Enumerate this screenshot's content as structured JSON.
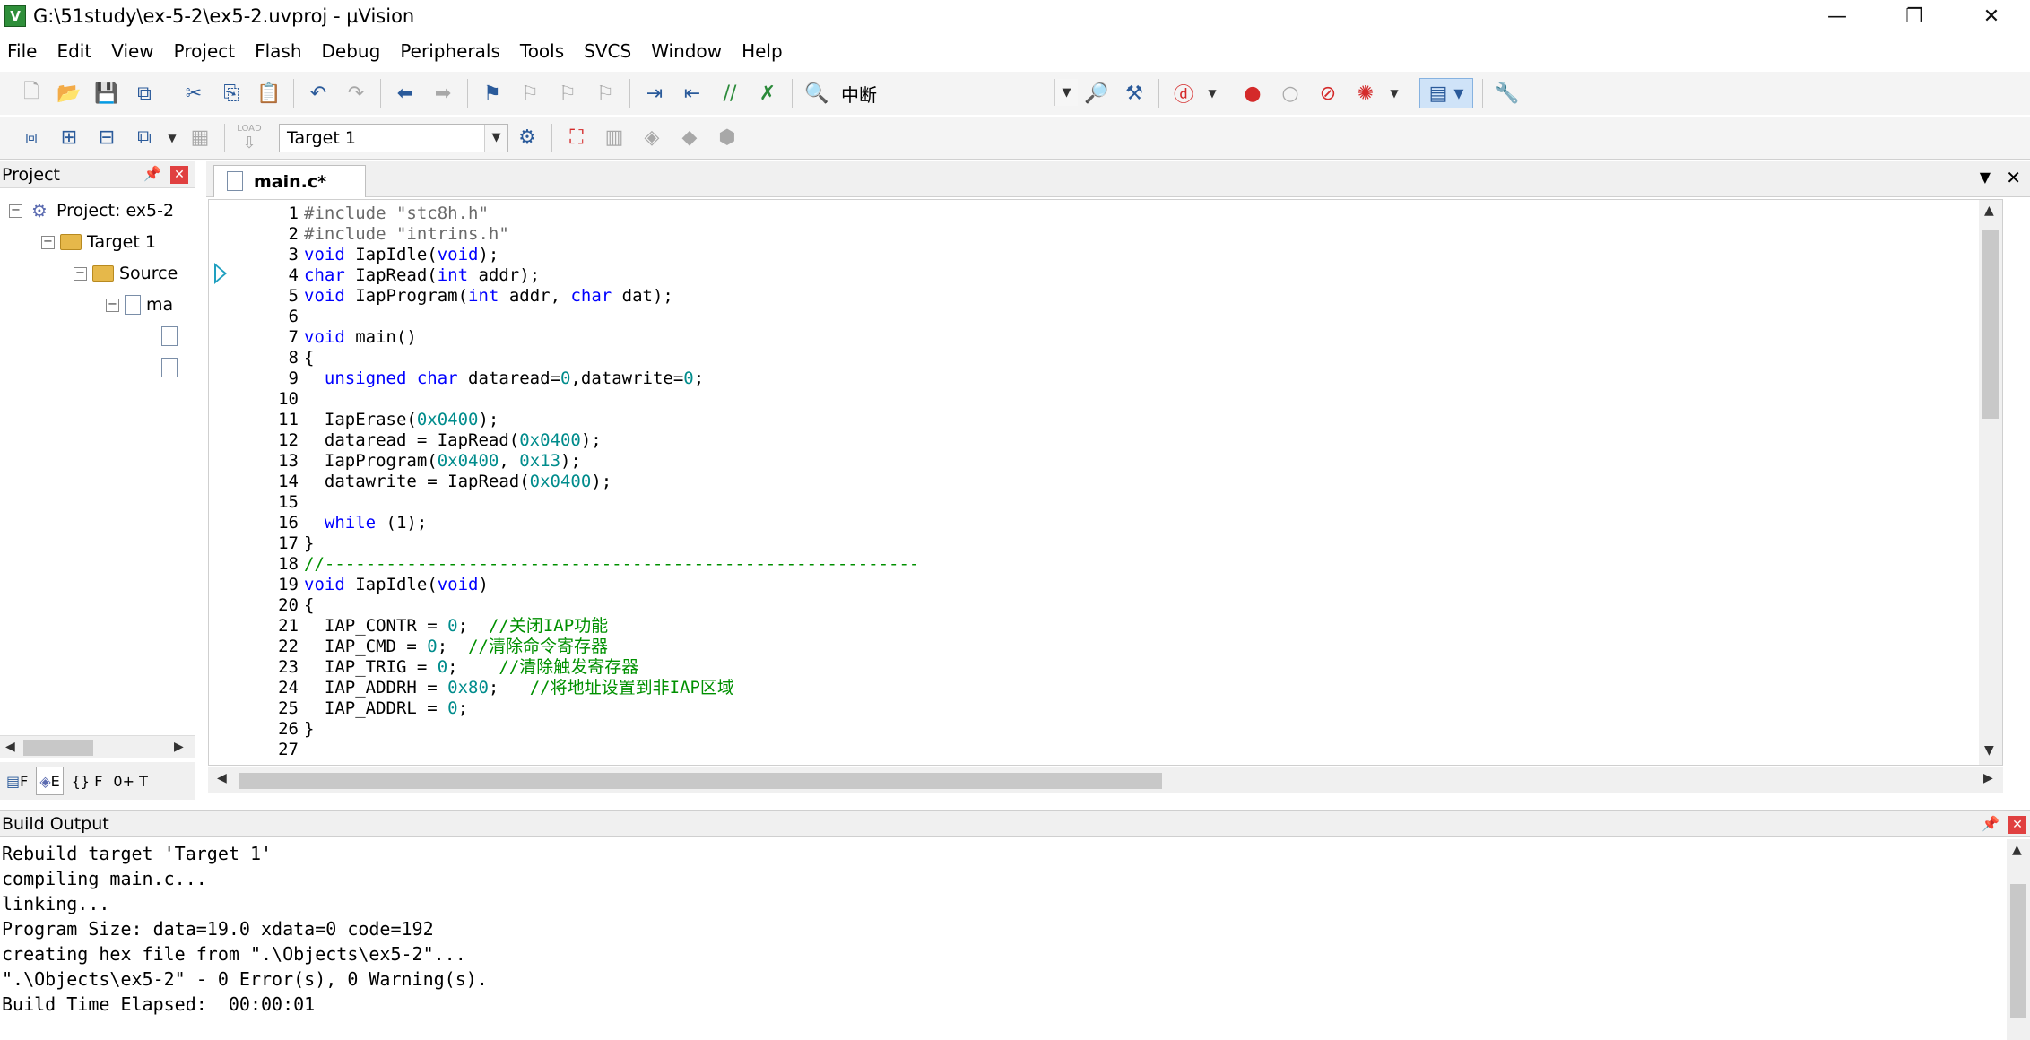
{
  "window": {
    "title": "G:\\51study\\ex-5-2\\ex5-2.uvproj - µVision",
    "minimize": "—",
    "restore": "❐",
    "close": "✕"
  },
  "menu": [
    "File",
    "Edit",
    "View",
    "Project",
    "Flash",
    "Debug",
    "Peripherals",
    "Tools",
    "SVCS",
    "Window",
    "Help"
  ],
  "toolbar1": {
    "find_text": "中断"
  },
  "toolbar2": {
    "load_label": "LOAD",
    "target": "Target 1"
  },
  "project": {
    "title": "Project",
    "tree": [
      {
        "label": "Project: ex5-2"
      },
      {
        "label": "Target 1"
      },
      {
        "label": "Source"
      },
      {
        "label": "ma"
      }
    ],
    "tabs": [
      "F",
      "E",
      "{} F",
      "0+ T"
    ]
  },
  "editor": {
    "tab": "main.c*",
    "lines": [
      "1",
      "2",
      "3",
      "4",
      "5",
      "6",
      "7",
      "8",
      "9",
      "10",
      "11",
      "12",
      "13",
      "14",
      "15",
      "16",
      "17",
      "18",
      "19",
      "20",
      "21",
      "22",
      "23",
      "24",
      "25",
      "26",
      "27"
    ],
    "code": {
      "l1a": "#include ",
      "l1b": "\"stc8h.h\"",
      "l2a": "#include ",
      "l2b": "\"intrins.h\"",
      "l3a": "void",
      "l3b": " IapIdle(",
      "l3c": "void",
      "l3d": ");",
      "l4a": "char",
      "l4b": " IapRead(",
      "l4c": "int",
      "l4d": " addr);",
      "l5a": "void",
      "l5b": " IapProgram(",
      "l5c": "int",
      "l5d": " addr, ",
      "l5e": "char",
      "l5f": " dat);",
      "l7a": "void",
      "l7b": " main()",
      "l8": "{",
      "l9a": "  unsigned char",
      "l9b": " dataread=",
      "l9c": "0",
      "l9d": ",datawrite=",
      "l9e": "0",
      "l9f": ";",
      "l11a": "  IapErase(",
      "l11b": "0x0400",
      "l11c": ");",
      "l12a": "  dataread = IapRead(",
      "l12b": "0x0400",
      "l12c": ");",
      "l13a": "  IapProgram(",
      "l13b": "0x0400",
      "l13c": ", ",
      "l13d": "0x13",
      "l13e": ");",
      "l14a": "  datawrite = IapRead(",
      "l14b": "0x0400",
      "l14c": ");",
      "l16a": "  while",
      "l16b": " (1);",
      "l17": "}",
      "l18": "//----------------------------------------------------------",
      "l19a": "void",
      "l19b": " IapIdle(",
      "l19c": "void",
      "l19d": ")",
      "l20": "{",
      "l21a": "  IAP_CONTR = ",
      "l21b": "0",
      "l21c": ";  ",
      "l21d": "//关闭IAP功能",
      "l22a": "  IAP_CMD = ",
      "l22b": "0",
      "l22c": ";  ",
      "l22d": "//清除命令寄存器",
      "l23a": "  IAP_TRIG = ",
      "l23b": "0",
      "l23c": ";    ",
      "l23d": "//清除触发寄存器",
      "l24a": "  IAP_ADDRH = ",
      "l24b": "0x80",
      "l24c": ";   ",
      "l24d": "//将地址设置到非IAP区域",
      "l25a": "  IAP_ADDRL = ",
      "l25b": "0",
      "l25c": ";",
      "l26": "}"
    }
  },
  "build_output": {
    "title": "Build Output",
    "lines": [
      "Rebuild target 'Target 1'",
      "compiling main.c...",
      "linking...",
      "Program Size: data=19.0 xdata=0 code=192",
      "creating hex file from \".\\Objects\\ex5-2\"...",
      "\".\\Objects\\ex5-2\" - 0 Error(s), 0 Warning(s).",
      "Build Time Elapsed:  00:00:01"
    ]
  }
}
